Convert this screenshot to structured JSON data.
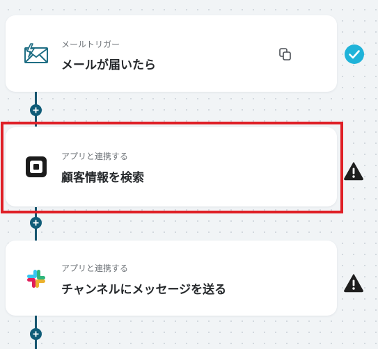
{
  "flow": {
    "steps": [
      {
        "subtitle": "メールトリガー",
        "title": "メールが届いたら",
        "icon": "mail-trigger-icon",
        "status": "completed"
      },
      {
        "subtitle": "アプリと連携する",
        "title": "顧客情報を検索",
        "icon": "square-app-icon",
        "status": "warning"
      },
      {
        "subtitle": "アプリと連携する",
        "title": "チャンネルにメッセージを送る",
        "icon": "slack-icon",
        "status": "warning"
      }
    ]
  },
  "colors": {
    "connector": "#16556f",
    "check_badge": "#1fb3d9",
    "highlight_border": "#df1f26",
    "warning_icon": "#1e1e1e"
  }
}
